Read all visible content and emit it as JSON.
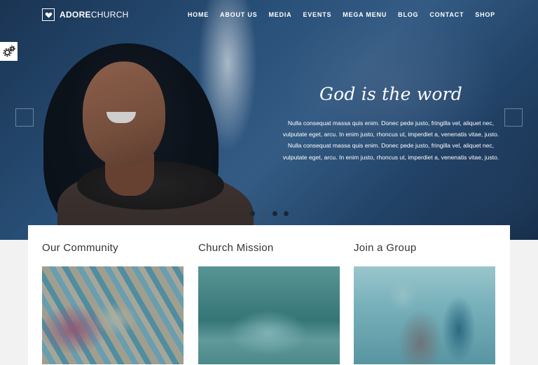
{
  "brand": {
    "bold": "ADORE",
    "thin": "CHURCH"
  },
  "nav": {
    "items": [
      {
        "label": "HOME"
      },
      {
        "label": "ABOUT US"
      },
      {
        "label": "MEDIA"
      },
      {
        "label": "EVENTS"
      },
      {
        "label": "MEGA MENU"
      },
      {
        "label": "BLOG"
      },
      {
        "label": "CONTACT"
      },
      {
        "label": "SHOP"
      }
    ]
  },
  "slider": {
    "title": "God is the word",
    "text": "Nulla consequat massa quis enim. Donec pede justo, fringilla vel, aliquet nec, vulputate eget, arcu. In enim justo, rhoncus ut, imperdiet a, venenatis vitae, justo. Nulla consequat massa quis enim. Donec pede justo, fringilla vel, aliquet nec, vulputate eget, arcu. In enim justo, rhoncus ut, imperdiet a, venenatis vitae, justo.",
    "slide_count": 4,
    "active_slide": 2
  },
  "features": [
    {
      "title": "Our Community",
      "image_subject": "stacked hands"
    },
    {
      "title": "Church Mission",
      "image_subject": "mountain lake"
    },
    {
      "title": "Join a Group",
      "image_subject": "group of people"
    }
  ],
  "colors": {
    "accent_tint": "#2a8c96",
    "nav_text": "#ffffff",
    "card_bg": "#ffffff",
    "heading": "#333333"
  },
  "icons": {
    "settings": "gear-icon",
    "logo": "heart-icon"
  }
}
